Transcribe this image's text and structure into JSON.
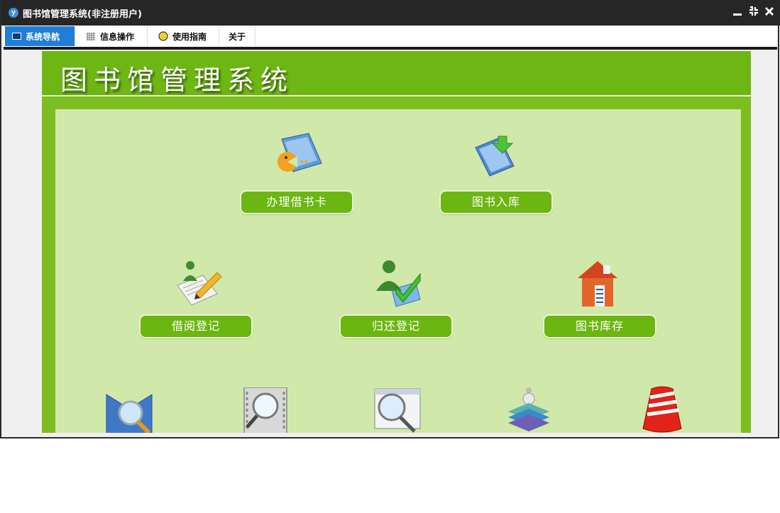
{
  "window": {
    "title": "图书馆管理系统(非注册用户)",
    "controls": [
      "minimize-icon",
      "restore-icon",
      "close-icon"
    ]
  },
  "menu": {
    "tabs": [
      {
        "label": "系统导航",
        "icon": "monitor-icon",
        "active": true
      },
      {
        "label": "信息操作",
        "icon": "grid-icon",
        "active": false
      },
      {
        "label": "使用指南",
        "icon": "help-bulb-icon",
        "active": false
      },
      {
        "label": "关于",
        "active": false
      }
    ]
  },
  "banner": {
    "title": "图书馆管理系统"
  },
  "functions": [
    {
      "label": "办理借书卡",
      "icon": "library-card-icon"
    },
    {
      "label": "图书入库",
      "icon": "book-import-icon"
    },
    {
      "label": "借阅登记",
      "icon": "borrow-register-icon"
    },
    {
      "label": "归还登记",
      "icon": "return-register-icon"
    },
    {
      "label": "图书库存",
      "icon": "book-inventory-icon"
    }
  ],
  "partial_icons": [
    "book-search-icon",
    "film-search-icon",
    "web-search-icon",
    "book-stack-icon",
    "alarm-bell-icon"
  ],
  "colors": {
    "titlebar": "#262626",
    "accent": "#1f7fd6",
    "banner": "#6eb614",
    "button": "#6cb611",
    "panel": "#d0e8a9"
  }
}
